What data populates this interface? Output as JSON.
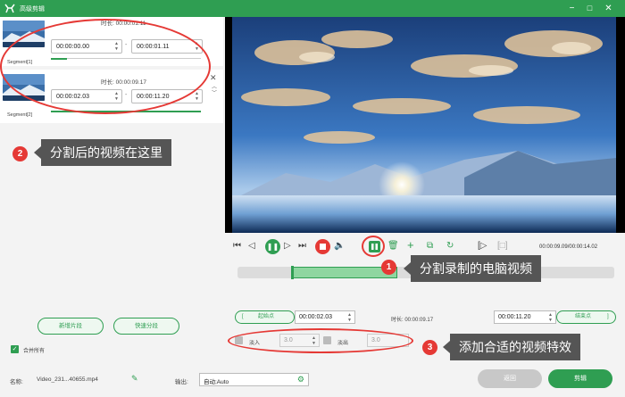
{
  "window": {
    "title": "高级剪辑"
  },
  "segments": [
    {
      "label": "Segment[1]",
      "duration": "时长: 00:00:01.11",
      "start": "00:00:00.00",
      "end": "00:00:01.11"
    },
    {
      "label": "Segment[2]",
      "duration": "时长: 00:00:09.17",
      "start": "00:00:02.03",
      "end": "00:00:11.20"
    }
  ],
  "left_buttons": {
    "new_segment": "新增片段",
    "quick_split": "快速分段",
    "merge_all": "合并所有"
  },
  "player": {
    "time_counter": "00:00:09.09/00:00:14.02"
  },
  "range": {
    "start_label": "起始点",
    "start_value": "00:00:02.03",
    "duration": "时长: 00:00:09.17",
    "end_value": "00:00:11.20",
    "end_label": "结束点"
  },
  "effects": {
    "fade_in_label": "淡入",
    "fade_in_value": "3.0",
    "fade_out_label": "淡出",
    "fade_out_value": "3.0"
  },
  "bottom": {
    "name_label": "名称:",
    "file_name": "Video_231...40655.mp4",
    "output_label": "输出:",
    "output_value": "自动;Auto",
    "back_label": "返回",
    "cut_label": "剪辑"
  },
  "annotations": [
    {
      "number": "1",
      "text": "分割录制的电脑视频"
    },
    {
      "number": "2",
      "text": "分割后的视频在这里"
    },
    {
      "number": "3",
      "text": "添加合适的视频特效"
    }
  ],
  "colors": {
    "accent": "#2f9e52",
    "annotation": "#e53935",
    "callout_bg": "#555555"
  }
}
